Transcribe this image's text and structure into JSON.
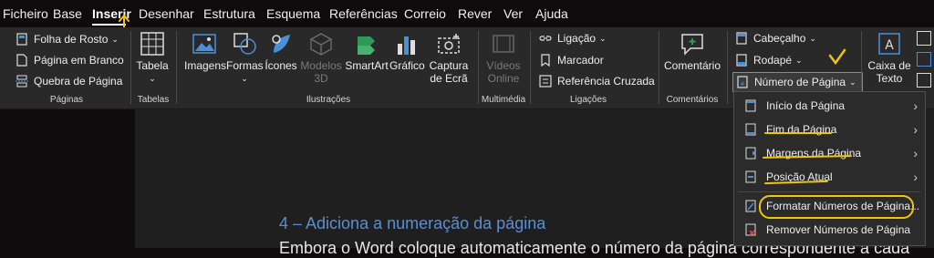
{
  "menu": [
    "Ficheiro",
    "Base",
    "Inserir",
    "Desenhar",
    "Estrutura",
    "Esquema",
    "Referências",
    "Correio",
    "Rever",
    "Ver",
    "Ajuda"
  ],
  "ribbon": {
    "paginas": {
      "label": "Páginas",
      "folha_rosto": "Folha de Rosto",
      "pagina_branco": "Página em Branco",
      "quebra_pagina": "Quebra de Página"
    },
    "tabelas": {
      "label": "Tabelas",
      "tabela": "Tabela"
    },
    "ilustracoes": {
      "label": "Ilustrações",
      "imagens": "Imagens",
      "formas": "Formas",
      "icones": "Ícones",
      "modelos3d_1": "Modelos",
      "modelos3d_2": "3D",
      "smartart": "SmartArt",
      "grafico": "Gráfico",
      "captura_1": "Captura",
      "captura_2": "de Ecrã"
    },
    "multimedia": {
      "label": "Multimédia",
      "videos_1": "Vídeos",
      "videos_2": "Online"
    },
    "ligacoes": {
      "label": "Ligações",
      "ligacao": "Ligação",
      "marcador": "Marcador",
      "referencia": "Referência Cruzada"
    },
    "comentarios": {
      "label": "Comentários",
      "comentario": "Comentário"
    },
    "cabecalho": {
      "cabecalho": "Cabeçalho",
      "rodape": "Rodapé",
      "numero_pagina": "Número de Página"
    },
    "texto": {
      "caixa_1": "Caixa de",
      "caixa_2": "Texto"
    }
  },
  "dropdown": {
    "items": [
      "Início da Página",
      "Fim da Página",
      "Margens da Página",
      "Posição Atual",
      "Formatar Números de Página...",
      "Remover Números de Página"
    ]
  },
  "document": {
    "heading": "4 – Adiciona a numeração da página",
    "body": "Embora o Word coloque automaticamente o número da página correspondente a cada"
  },
  "colors": {
    "accent": "#4a90d9",
    "highlight": "#f2c40f",
    "ribbon": "#292929"
  }
}
